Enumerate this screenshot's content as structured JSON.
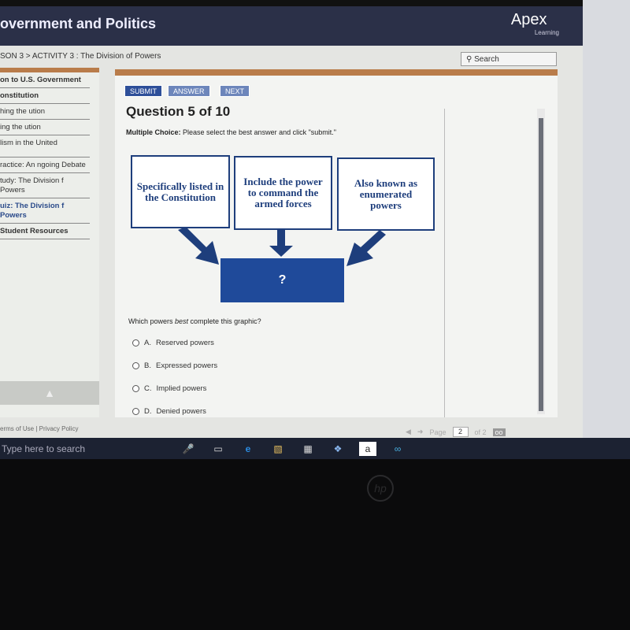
{
  "header": {
    "title": "overnment and Politics",
    "logo": "Apex",
    "logo_sub": "Learning"
  },
  "breadcrumb": "SON 3 > ACTIVITY 3 : The Division of Powers",
  "search": {
    "label": "Search"
  },
  "sidebar": {
    "items": [
      {
        "label": "on to U.S. Government",
        "style": "bold"
      },
      {
        "label": "onstitution",
        "style": "bold"
      },
      {
        "label": "hing the ution"
      },
      {
        "label": "ing the ution"
      },
      {
        "label": "lism in the United"
      },
      {
        "label": "ractice: An ngoing Debate"
      },
      {
        "label": "tudy: The Division f Powers"
      },
      {
        "label": "uiz: The Division f Powers",
        "style": "active"
      },
      {
        "label": "Student Resources",
        "style": "bold"
      }
    ],
    "up_icon": "arrow-up-icon"
  },
  "footer": {
    "terms": "erms of Use",
    "sep": "|",
    "privacy": "Privacy Policy"
  },
  "toolbar": {
    "submit": "SUBMIT",
    "answer": "ANSWER",
    "next": "NEXT"
  },
  "question": {
    "title": "Question 5 of 10",
    "instr_bold": "Multiple Choice:",
    "instr": " Please select the best answer and click \"submit.\"",
    "boxes": [
      "Specifically listed in the Constitution",
      "Include the power to command the armed forces",
      "Also known as enumerated powers"
    ],
    "center": "?",
    "prompt_a": "Which powers ",
    "prompt_em": "best",
    "prompt_b": " complete this graphic?",
    "options": [
      {
        "letter": "A.",
        "text": "Reserved powers"
      },
      {
        "letter": "B.",
        "text": "Expressed powers"
      },
      {
        "letter": "C.",
        "text": "Implied powers"
      },
      {
        "letter": "D.",
        "text": "Denied powers"
      }
    ]
  },
  "pager": {
    "label": "Page",
    "value": "2",
    "of": "of 2"
  },
  "taskbar": {
    "search": "Type here to search",
    "store": "a"
  },
  "colors": {
    "navy": "#2b3048",
    "accent": "#b97c4a",
    "diagram": "#1e3e7c"
  }
}
